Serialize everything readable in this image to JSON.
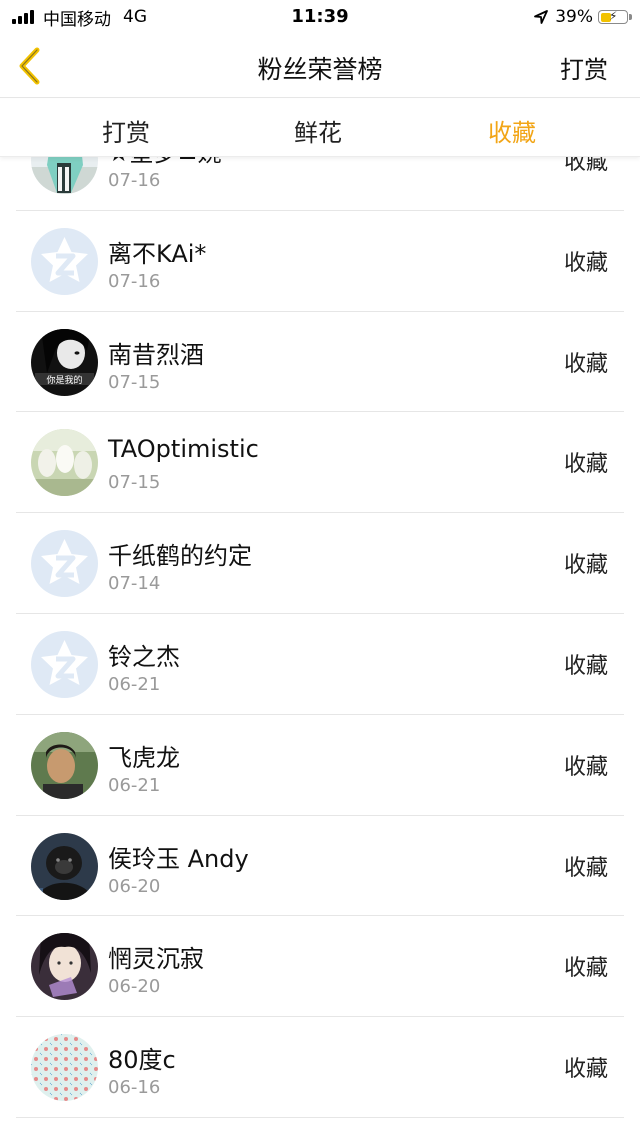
{
  "status_bar": {
    "carrier": "中国移动",
    "network": "4G",
    "time": "11:39",
    "battery": "39%"
  },
  "header": {
    "title": "粉丝荣誉榜",
    "action_label": "打赏",
    "back_icon": "chevron-left-icon",
    "accent_color": "#f2c200"
  },
  "tabs": [
    {
      "label": "打赏",
      "active": false
    },
    {
      "label": "鲜花",
      "active": false
    },
    {
      "label": "收藏",
      "active": true
    }
  ],
  "tab_active_color": "#f2a516",
  "items": [
    {
      "name": "★星梦≌婉",
      "date": "07-16",
      "action": "收藏",
      "avatar": "anime-figure"
    },
    {
      "name": "离不KAi*",
      "date": "07-16",
      "action": "收藏",
      "avatar": "default-qq"
    },
    {
      "name": "南昔烈酒",
      "date": "07-15",
      "action": "收藏",
      "avatar": "bw-portrait"
    },
    {
      "name": "TAOptimistic",
      "date": "07-15",
      "action": "收藏",
      "avatar": "anime-group"
    },
    {
      "name": "千纸鹤的约定",
      "date": "07-14",
      "action": "收藏",
      "avatar": "default-qq"
    },
    {
      "name": "铃之杰",
      "date": "06-21",
      "action": "收藏",
      "avatar": "default-qq"
    },
    {
      "name": "飞虎龙",
      "date": "06-21",
      "action": "收藏",
      "avatar": "man-photo"
    },
    {
      "name": "侯玲玉 Andy",
      "date": "06-20",
      "action": "收藏",
      "avatar": "gorilla"
    },
    {
      "name": "惘灵沉寂",
      "date": "06-20",
      "action": "收藏",
      "avatar": "anime-dark"
    },
    {
      "name": "80度c",
      "date": "06-16",
      "action": "收藏",
      "avatar": "pattern"
    }
  ]
}
